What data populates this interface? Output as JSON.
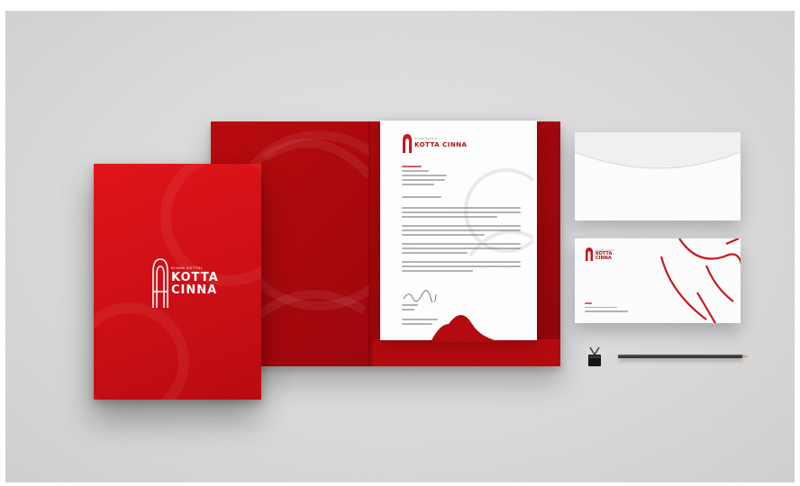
{
  "brand": {
    "tagline": "KIVAM KOTTAI",
    "name_line1": "KOTTA",
    "name_line2": "CINNA"
  },
  "letterhead": {
    "tagline": "KIVAM KOTTAI",
    "name": "KOTTA CINNA"
  },
  "envelope": {
    "tagline": "KIVAM KOTTAI",
    "name_line1": "KOTTA",
    "name_line2": "CINNA"
  },
  "colors": {
    "brand_red": "#c80d12",
    "dark_red": "#8e0308",
    "paper": "#ffffff",
    "background": "#dadada"
  },
  "icons": [
    "temple-logo-icon",
    "binder-clip-icon",
    "pencil-icon"
  ]
}
